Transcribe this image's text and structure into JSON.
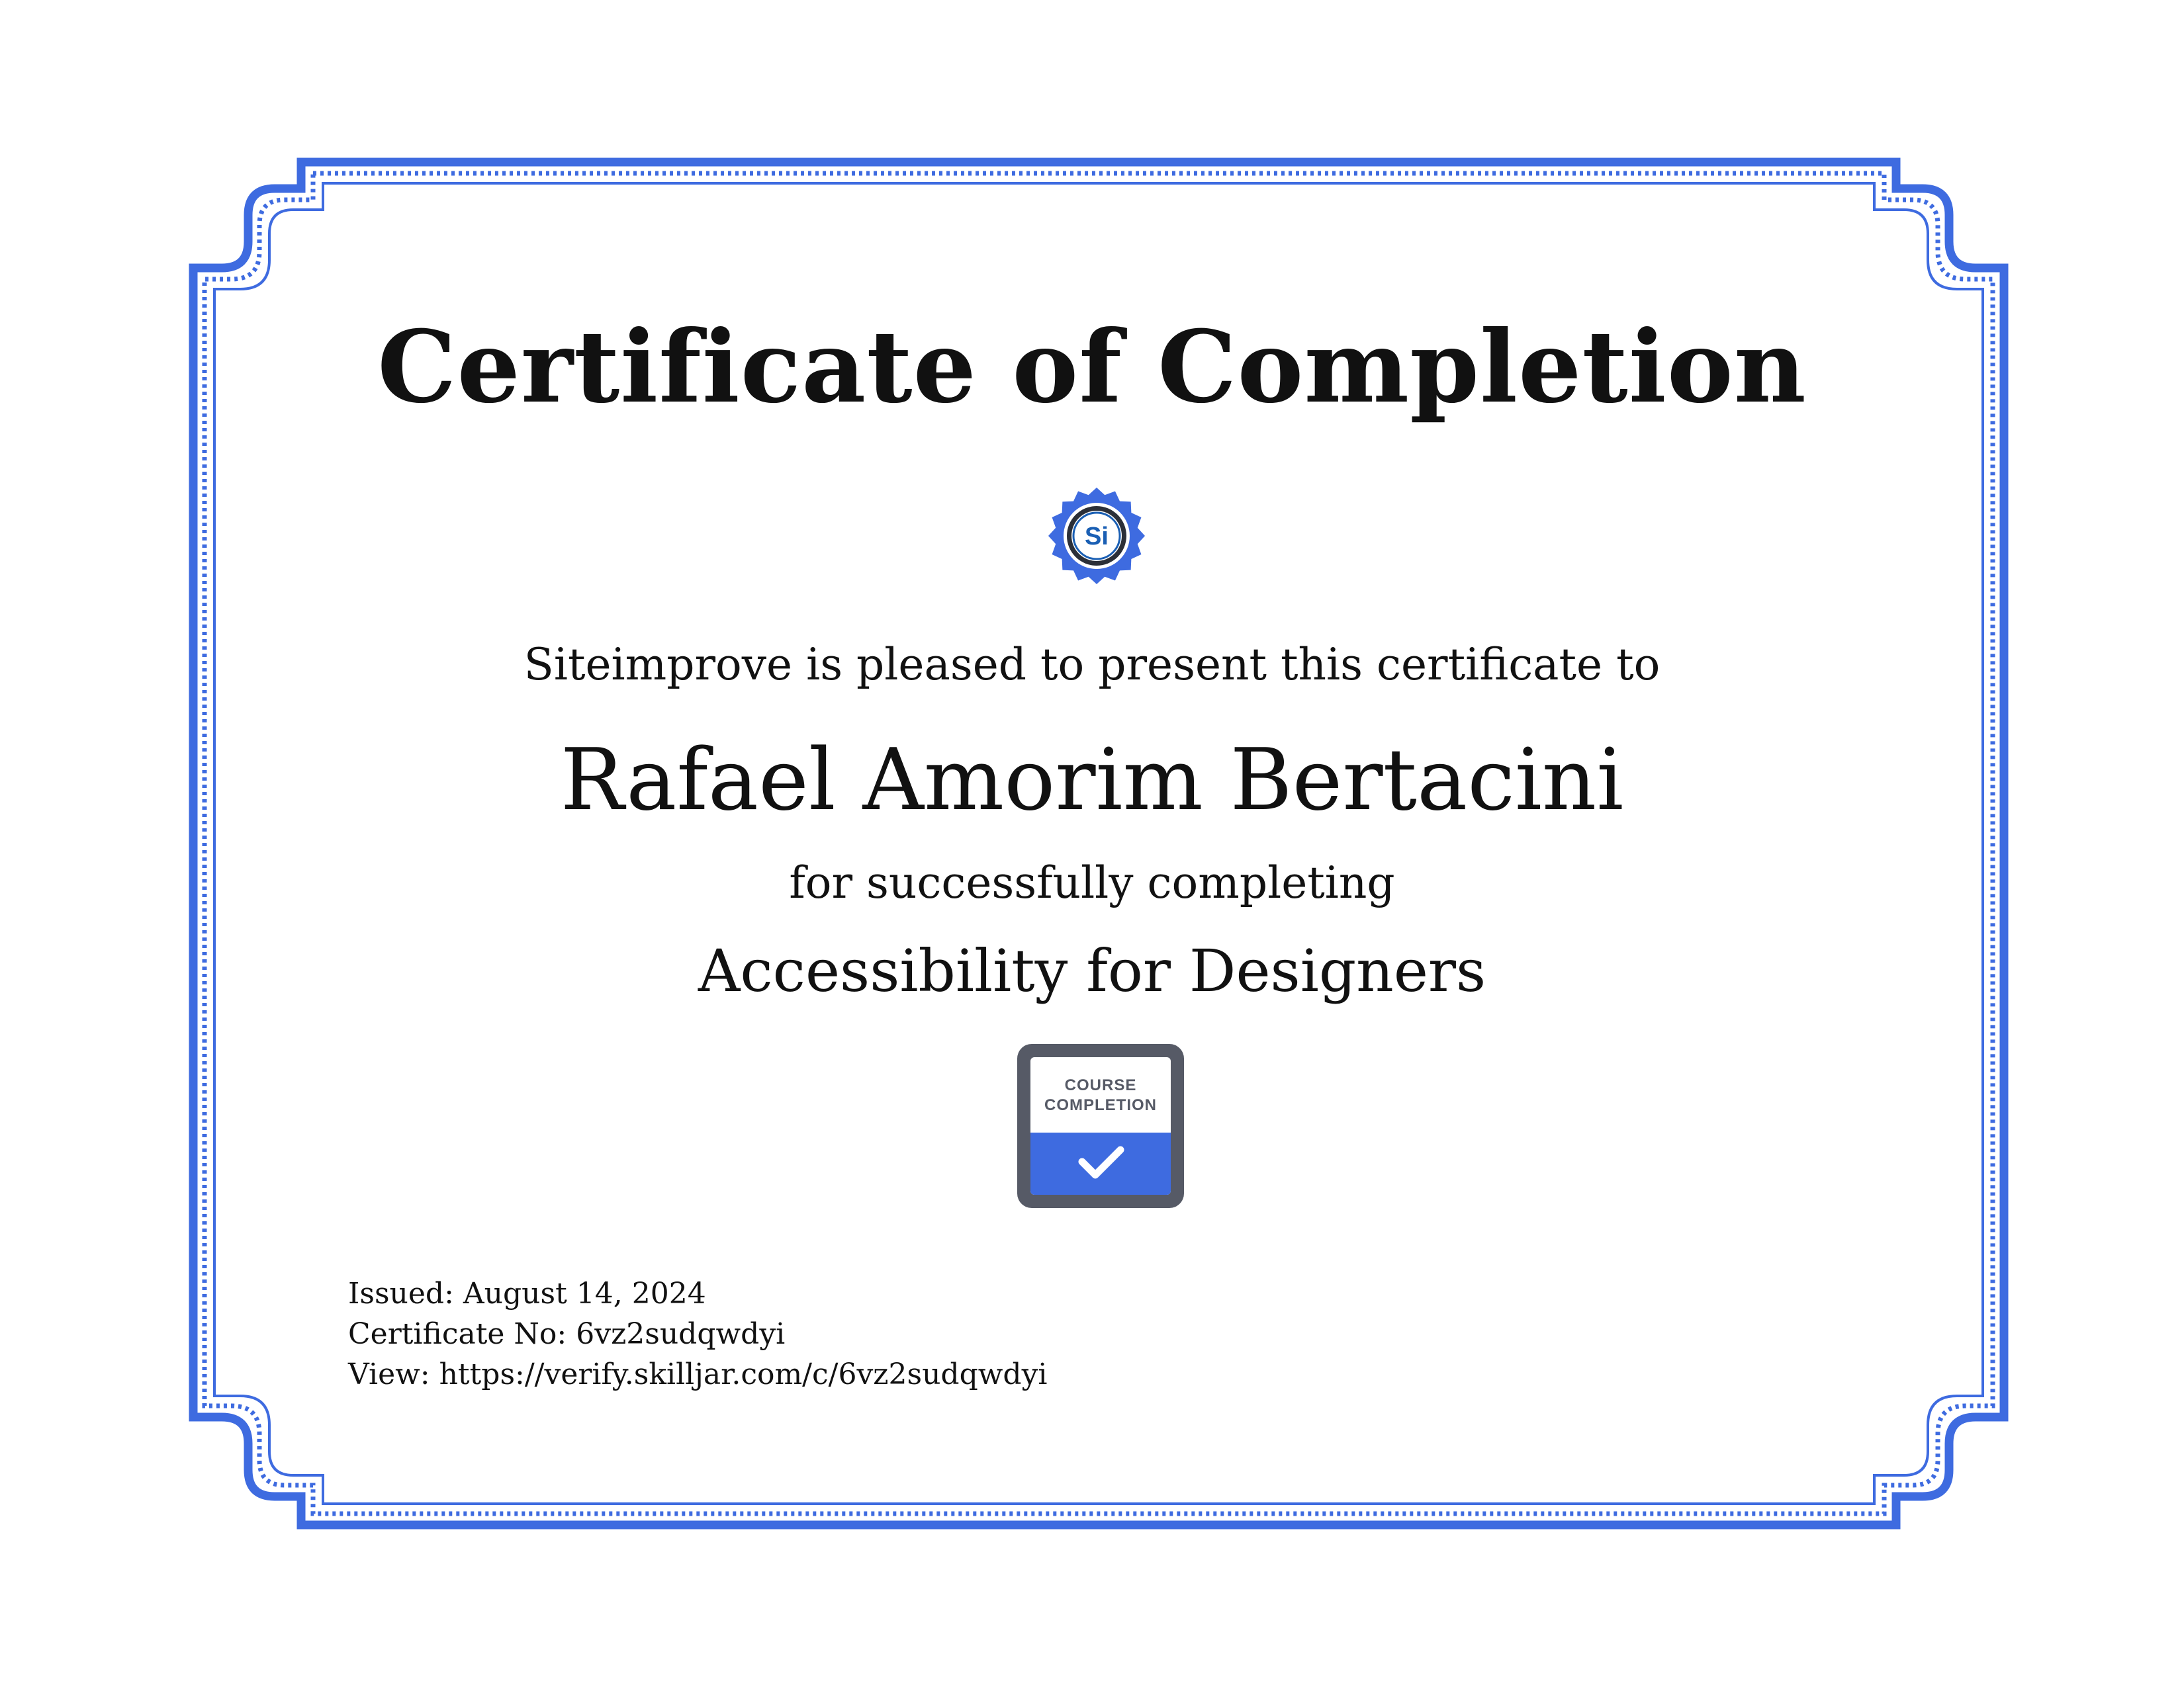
{
  "certificate": {
    "title": "Certificate of Completion",
    "presented_line": "Siteimprove is pleased to present this certificate to",
    "recipient": "Rafael Amorim Bertacini",
    "completing_line": "for successfully completing",
    "course": "Accessibility for Designers"
  },
  "seal": {
    "text": "Si",
    "icon": "siteimprove-seal-icon"
  },
  "badge": {
    "line1": "COURSE",
    "line2": "COMPLETION",
    "icon": "checkmark-icon"
  },
  "meta": {
    "issued": "Issued: August 14, 2024",
    "certificate_no": "Certificate No: 6vz2sudqwdyi",
    "view": "View: https://verify.skilljar.com/c/6vz2sudqwdyi"
  },
  "colors": {
    "border": "#3e6be0",
    "text": "#111111",
    "badge_gray": "#565a66",
    "seal_blue": "#1a5fb4"
  }
}
